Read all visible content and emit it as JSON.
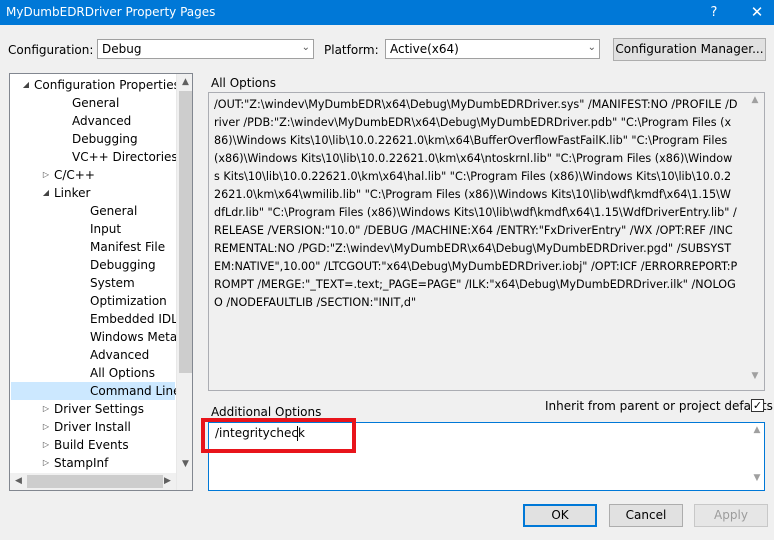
{
  "window": {
    "title": "MyDumbEDRDriver Property Pages",
    "help_glyph": "?",
    "close_glyph": "✕"
  },
  "config": {
    "configuration_label": "Configuration:",
    "configuration_value": "Debug",
    "platform_label": "Platform:",
    "platform_value": "Active(x64)",
    "manager_button": "Configuration Manager..."
  },
  "tree": {
    "items": [
      {
        "label": "Configuration Properties",
        "expander": "◢"
      },
      {
        "label": "General",
        "expander": ""
      },
      {
        "label": "Advanced",
        "expander": ""
      },
      {
        "label": "Debugging",
        "expander": ""
      },
      {
        "label": "VC++ Directories",
        "expander": ""
      },
      {
        "label": "C/C++",
        "expander": "▷"
      },
      {
        "label": "Linker",
        "expander": "◢"
      },
      {
        "label": "General",
        "expander": ""
      },
      {
        "label": "Input",
        "expander": ""
      },
      {
        "label": "Manifest File",
        "expander": ""
      },
      {
        "label": "Debugging",
        "expander": ""
      },
      {
        "label": "System",
        "expander": ""
      },
      {
        "label": "Optimization",
        "expander": ""
      },
      {
        "label": "Embedded IDL",
        "expander": ""
      },
      {
        "label": "Windows Metadata",
        "expander": ""
      },
      {
        "label": "Advanced",
        "expander": ""
      },
      {
        "label": "All Options",
        "expander": ""
      },
      {
        "label": "Command Line",
        "expander": ""
      },
      {
        "label": "Driver Settings",
        "expander": "▷"
      },
      {
        "label": "Driver Install",
        "expander": "▷"
      },
      {
        "label": "Build Events",
        "expander": "▷"
      },
      {
        "label": "StampInf",
        "expander": "▷"
      }
    ],
    "selected_label": "Command Line"
  },
  "all_options": {
    "label": "All Options",
    "text": "/OUT:\"Z:\\windev\\MyDumbEDR\\x64\\Debug\\MyDumbEDRDriver.sys\" /MANIFEST:NO /PROFILE /Driver /PDB:\"Z:\\windev\\MyDumbEDR\\x64\\Debug\\MyDumbEDRDriver.pdb\" \"C:\\Program Files (x86)\\Windows Kits\\10\\lib\\10.0.22621.0\\km\\x64\\BufferOverflowFastFailK.lib\" \"C:\\Program Files (x86)\\Windows Kits\\10\\lib\\10.0.22621.0\\km\\x64\\ntoskrnl.lib\" \"C:\\Program Files (x86)\\Windows Kits\\10\\lib\\10.0.22621.0\\km\\x64\\hal.lib\" \"C:\\Program Files (x86)\\Windows Kits\\10\\lib\\10.0.22621.0\\km\\x64\\wmilib.lib\" \"C:\\Program Files (x86)\\Windows Kits\\10\\lib\\wdf\\kmdf\\x64\\1.15\\WdfLdr.lib\" \"C:\\Program Files (x86)\\Windows Kits\\10\\lib\\wdf\\kmdf\\x64\\1.15\\WdfDriverEntry.lib\" /RELEASE /VERSION:\"10.0\" /DEBUG /MACHINE:X64 /ENTRY:\"FxDriverEntry\" /WX /OPT:REF /INCREMENTAL:NO /PGD:\"Z:\\windev\\MyDumbEDR\\x64\\Debug\\MyDumbEDRDriver.pgd\" /SUBSYSTEM:NATIVE\",10.00\" /LTCGOUT:\"x64\\Debug\\MyDumbEDRDriver.iobj\" /OPT:ICF /ERRORREPORT:PROMPT /MERGE:\"_TEXT=.text;_PAGE=PAGE\" /ILK:\"x64\\Debug\\MyDumbEDRDriver.ilk\" /NOLOGO /NODEFAULTLIB /SECTION:\"INIT,d\""
  },
  "additional_options": {
    "label": "Additional Options",
    "value": "/integritycheck",
    "inherit_label": "Inherit from parent or project defaults",
    "inherit_checked": true,
    "check_glyph": "✓"
  },
  "buttons": {
    "ok": "OK",
    "cancel": "Cancel",
    "apply": "Apply"
  },
  "colors": {
    "title_bar": "#0078d7",
    "highlight": "#e8141b",
    "selection": "#cce8ff"
  }
}
